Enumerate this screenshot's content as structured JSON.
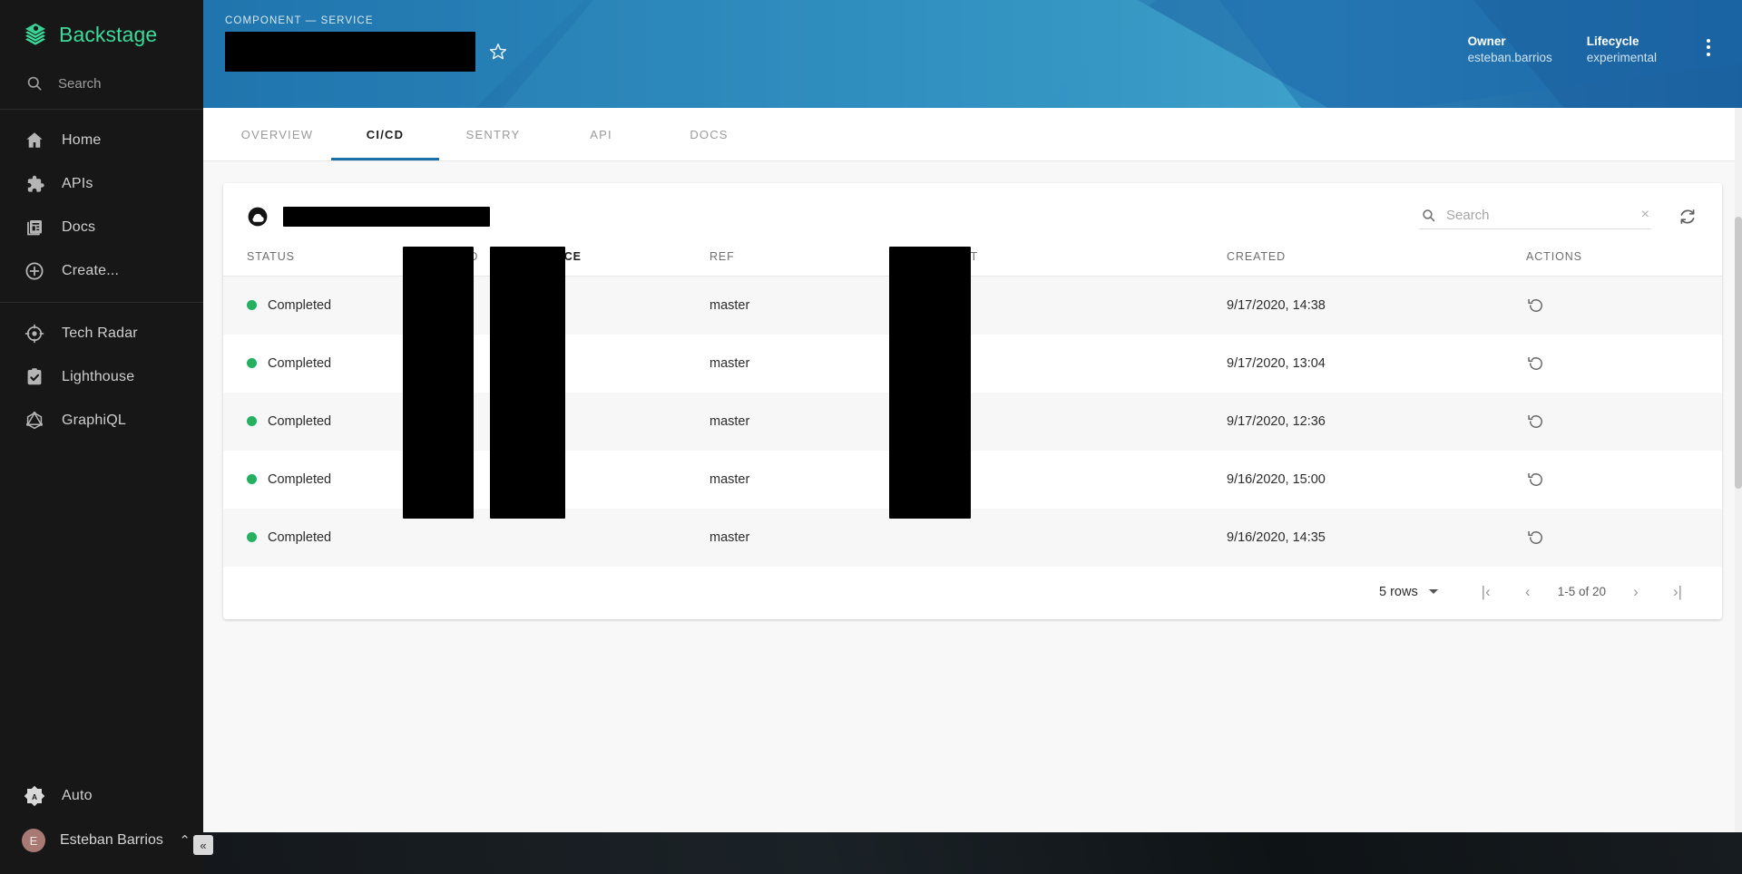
{
  "sidebar": {
    "brand": "Backstage",
    "search_placeholder": "Search",
    "group1": [
      {
        "label": "Home",
        "icon": "home-icon"
      },
      {
        "label": "APIs",
        "icon": "puzzle-icon"
      },
      {
        "label": "Docs",
        "icon": "docs-icon"
      },
      {
        "label": "Create...",
        "icon": "plus-circle-icon"
      }
    ],
    "group2": [
      {
        "label": "Tech Radar",
        "icon": "radar-icon"
      },
      {
        "label": "Lighthouse",
        "icon": "clipboard-check-icon"
      },
      {
        "label": "GraphiQL",
        "icon": "graphql-icon"
      }
    ],
    "bottom": {
      "theme_label": "Auto",
      "theme_icon": "brightness-auto-icon",
      "user_name": "Esteban Barrios",
      "user_initial": "E",
      "chevron": "⌃",
      "collapse_label": "«"
    }
  },
  "header": {
    "kicker": "COMPONENT — SERVICE",
    "title_redacted": true,
    "star_icon": "star-outline-icon",
    "fields": [
      {
        "label": "Owner",
        "value": "esteban.barrios"
      },
      {
        "label": "Lifecycle",
        "value": "experimental"
      }
    ],
    "overflow_icon": "more-vert-icon"
  },
  "tabs": [
    {
      "label": "OVERVIEW",
      "active": false
    },
    {
      "label": "CI/CD",
      "active": true
    },
    {
      "label": "SENTRY",
      "active": false
    },
    {
      "label": "API",
      "active": false
    },
    {
      "label": "DOCS",
      "active": false
    }
  ],
  "card": {
    "project_icon": "circleci-cloud-icon",
    "project_redacted": true,
    "search": {
      "placeholder": "Search",
      "value": "",
      "clear_label": "×"
    },
    "refresh_icon": "refresh-icon",
    "columns": [
      {
        "key": "status",
        "label": "STATUS",
        "sorted": false
      },
      {
        "key": "build",
        "label": "BUILD",
        "sorted": false
      },
      {
        "key": "source",
        "label": "SOURCE",
        "sorted": true
      },
      {
        "key": "ref",
        "label": "REF",
        "sorted": false
      },
      {
        "key": "commit",
        "label": "COMMIT",
        "sorted": false
      },
      {
        "key": "created",
        "label": "CREATED",
        "sorted": false
      },
      {
        "key": "actions",
        "label": "ACTIONS",
        "sorted": false
      }
    ],
    "rows": [
      {
        "status": "Completed",
        "status_color": "#23b05f",
        "build": "",
        "source": "",
        "ref": "master",
        "commit": "",
        "created": "9/17/2020, 14:38",
        "action_icon": "retry-icon"
      },
      {
        "status": "Completed",
        "status_color": "#23b05f",
        "build": "",
        "source": "",
        "ref": "master",
        "commit": "",
        "created": "9/17/2020, 13:04",
        "action_icon": "retry-icon"
      },
      {
        "status": "Completed",
        "status_color": "#23b05f",
        "build": "",
        "source": "",
        "ref": "master",
        "commit": "",
        "created": "9/17/2020, 12:36",
        "action_icon": "retry-icon"
      },
      {
        "status": "Completed",
        "status_color": "#23b05f",
        "build": "",
        "source": "",
        "ref": "master",
        "commit": "",
        "created": "9/16/2020, 15:00",
        "action_icon": "retry-icon"
      },
      {
        "status": "Completed",
        "status_color": "#23b05f",
        "build": "",
        "source": "",
        "ref": "master",
        "commit": "",
        "created": "9/16/2020, 14:35",
        "action_icon": "retry-icon"
      }
    ],
    "pagination": {
      "rows_label": "5 rows",
      "first_label": "|‹",
      "prev_label": "‹",
      "range": "1-5 of 20",
      "next_label": "›",
      "last_label": "›|"
    }
  },
  "colors": {
    "brand_green": "#3bdb9b",
    "header_blue": "#2077b3",
    "tab_active": "#1b6fa8",
    "status_green": "#23b05f",
    "sidebar_bg": "#171717"
  }
}
